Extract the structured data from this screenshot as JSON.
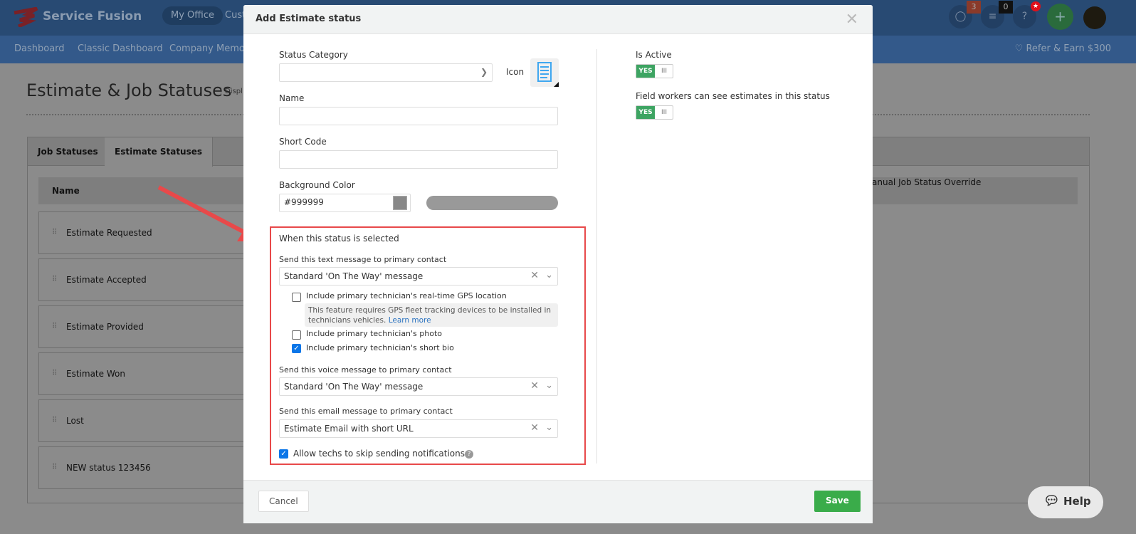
{
  "app": {
    "brand": "Service Fusion",
    "nav": [
      "My Office",
      "Cust"
    ],
    "subnav": [
      "Dashboard",
      "Classic Dashboard",
      "Company Memos"
    ],
    "refer": "Refer & Earn $300",
    "badges": {
      "chat": "3",
      "tasks": "0"
    },
    "help_label": "?",
    "add_label": "+"
  },
  "page": {
    "title": "Estimate & Job Statuses",
    "subtitle": "Displ",
    "tabs": [
      "Job Statuses",
      "Estimate Statuses"
    ],
    "column_name": "Name",
    "column_override": "anual Job Status Override",
    "rows": [
      "Estimate Requested",
      "Estimate Accepted",
      "Estimate Provided",
      "Estimate Won",
      "Lost",
      "NEW status 123456"
    ]
  },
  "modal": {
    "title": "Add Estimate status",
    "status_category_label": "Status Category",
    "status_category_value": "",
    "icon_label": "Icon",
    "name_label": "Name",
    "name_value": "",
    "short_code_label": "Short Code",
    "short_code_value": "",
    "bg_color_label": "Background Color",
    "bg_color_value": "#999999",
    "bg_color": "#999999",
    "is_active_label": "Is Active",
    "is_active": true,
    "field_workers_label": "Field workers can see estimates in this status",
    "field_workers": true,
    "toggle_yes": "YES",
    "toggle_no": "III",
    "when_selected": "When this status is selected",
    "text_label": "Send this text message to primary contact",
    "text_value": "Standard 'On The Way' message",
    "gps_label": "Include primary technician's real-time GPS location",
    "gps_checked": false,
    "gps_note": "This feature requires GPS fleet tracking devices to be installed in technicians vehicles.",
    "learn_more": "Learn more",
    "photo_label": "Include primary technician's photo",
    "photo_checked": false,
    "bio_label": "Include primary technician's short bio",
    "bio_checked": true,
    "voice_label": "Send this voice message to primary contact",
    "voice_value": "Standard 'On The Way' message",
    "email_label": "Send this email message to primary contact",
    "email_value": "Estimate Email with short URL",
    "skip_label": "Allow techs to skip sending notifications",
    "skip_checked": true,
    "cancel": "Cancel",
    "save": "Save"
  },
  "help_widget": "Help",
  "colors": {
    "accent_green": "#3aac4a",
    "highlight": "#e8494a",
    "nav": "#284a73"
  }
}
